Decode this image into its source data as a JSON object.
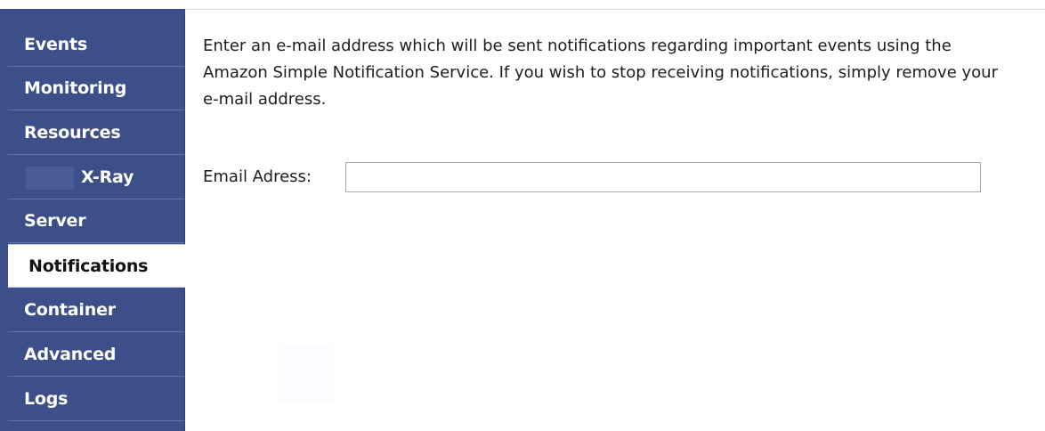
{
  "sidebar": {
    "items": [
      {
        "label": "Events"
      },
      {
        "label": "Monitoring"
      },
      {
        "label": "Resources"
      },
      {
        "label": "X-Ray"
      },
      {
        "label": "Server"
      },
      {
        "label": "Notifications"
      },
      {
        "label": "Container"
      },
      {
        "label": "Advanced"
      },
      {
        "label": "Logs"
      }
    ],
    "active": "Notifications"
  },
  "main": {
    "description": "Enter an e-mail address which will be sent notifications regarding important events using the Amazon Simple Notification Service. If you wish to stop receiving notifications, simply remove your e-mail address.",
    "email_label": "Email Adress:",
    "email_value": ""
  }
}
